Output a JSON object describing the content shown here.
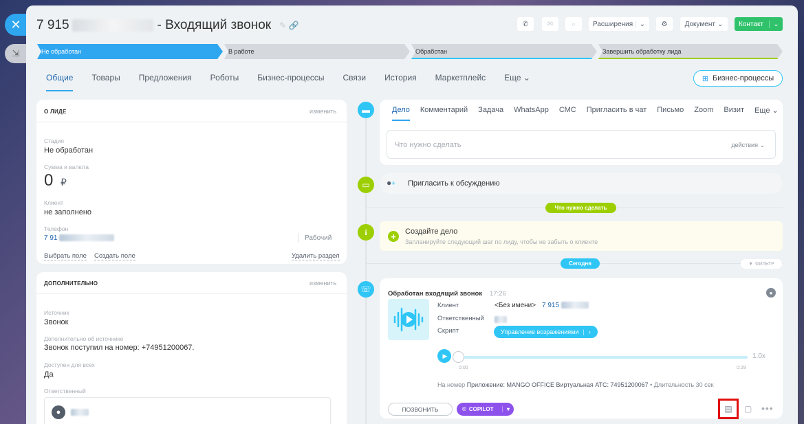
{
  "header": {
    "title_prefix": "7 915",
    "title": "- Входящий звонок",
    "extensions_label": "Расширения",
    "document_label": "Документ",
    "contact_label": "Контакт"
  },
  "stages": [
    {
      "label": "Не обработан",
      "color": "#2fa6f0",
      "active": true
    },
    {
      "label": "В работе",
      "color": "#d5d9de",
      "active": false
    },
    {
      "label": "Обработан",
      "color": "#d5d9de",
      "active": false
    },
    {
      "label": "Завершить обработку лида",
      "color": "#d5d9de",
      "active": false
    }
  ],
  "tabs": [
    "Общие",
    "Товары",
    "Предложения",
    "Роботы",
    "Бизнес-процессы",
    "Связи",
    "История",
    "Маркетплейс",
    "Еще"
  ],
  "bp_button": "Бизнес-процессы",
  "about": {
    "heading": "О ЛИДЕ",
    "edit": "изменить",
    "stage_label": "Стадия",
    "stage_value": "Не обработан",
    "amount_label": "Сумма и валюта",
    "amount_value": "0",
    "currency": "₽",
    "client_label": "Клиент",
    "client_value": "не заполнено",
    "phone_label": "Телефон",
    "phone_value": "7 91",
    "phone_type": "Рабочий",
    "select_field": "Выбрать поле",
    "create_field": "Создать поле",
    "delete_section": "Удалить раздел"
  },
  "extra": {
    "heading": "ДОПОЛНИТЕЛЬНО",
    "edit": "изменить",
    "source_label": "Источник",
    "source_value": "Звонок",
    "source_info_label": "Дополнительно об источнике",
    "source_info_value": "Звонок поступил на номер: +74951200067.",
    "available_label": "Доступен для всех",
    "available_value": "Да",
    "responsible_label": "Ответственный"
  },
  "activity": {
    "tabs": [
      "Дело",
      "Комментарий",
      "Задача",
      "WhatsApp",
      "СМС",
      "Пригласить в чат",
      "Письмо",
      "Zoom",
      "Визит",
      "Еще"
    ],
    "placeholder": "Что нужно сделать",
    "actions": "действия",
    "invite": "Пригласить к обсуждению",
    "todo_pill": "Что нужно сделать",
    "create_title": "Создайте дело",
    "create_sub": "Запланируйте следующий шаг по лиду, чтобы не забыть о клиенте",
    "today_pill": "Сегодня",
    "filter": "ФИЛЬТР"
  },
  "call": {
    "title": "Обработан входящий звонок",
    "time": "17:26",
    "client_label": "Клиент",
    "client_value": "<Без имени>",
    "client_phone": "7 915",
    "responsible_label": "Ответственный",
    "script_label": "Скрипт",
    "script_value": "Управление возражениями",
    "speed": "1.0x",
    "time_start": "0:00",
    "time_end": "0:29",
    "progress": 0,
    "info_prefix": "На номер",
    "info": "Приложение: MANGO OFFICE Виртуальная АТС: 74951200067",
    "duration": "Длительность 30 сек",
    "call_button": "ПОЗВОНИТЬ",
    "copilot_button": "COPILOT"
  }
}
